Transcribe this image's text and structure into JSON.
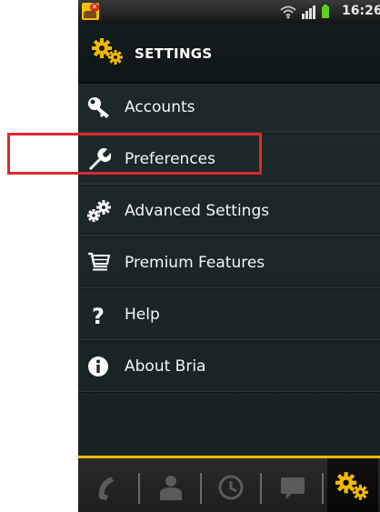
{
  "status_bar": {
    "time": "16:26",
    "icons": [
      "bria-app-icon",
      "wifi-icon",
      "signal-icon",
      "battery-icon"
    ]
  },
  "header": {
    "title": "SETTINGS",
    "icon": "gears-icon"
  },
  "menu": {
    "items": [
      {
        "label": "Accounts",
        "icon": "key-icon"
      },
      {
        "label": "Preferences",
        "icon": "wrench-icon",
        "highlighted": true
      },
      {
        "label": "Advanced Settings",
        "icon": "gears-icon"
      },
      {
        "label": "Premium Features",
        "icon": "cart-icon"
      },
      {
        "label": "Help",
        "icon": "question-icon"
      },
      {
        "label": "About Bria",
        "icon": "info-icon"
      }
    ]
  },
  "tab_bar": {
    "tabs": [
      "phone-icon",
      "contacts-icon",
      "history-icon",
      "messages-icon",
      "settings-icon"
    ],
    "active": "settings-icon"
  },
  "colors": {
    "accent": "#f3b900",
    "highlight_box": "#e3262b",
    "background": "#1b2627"
  }
}
